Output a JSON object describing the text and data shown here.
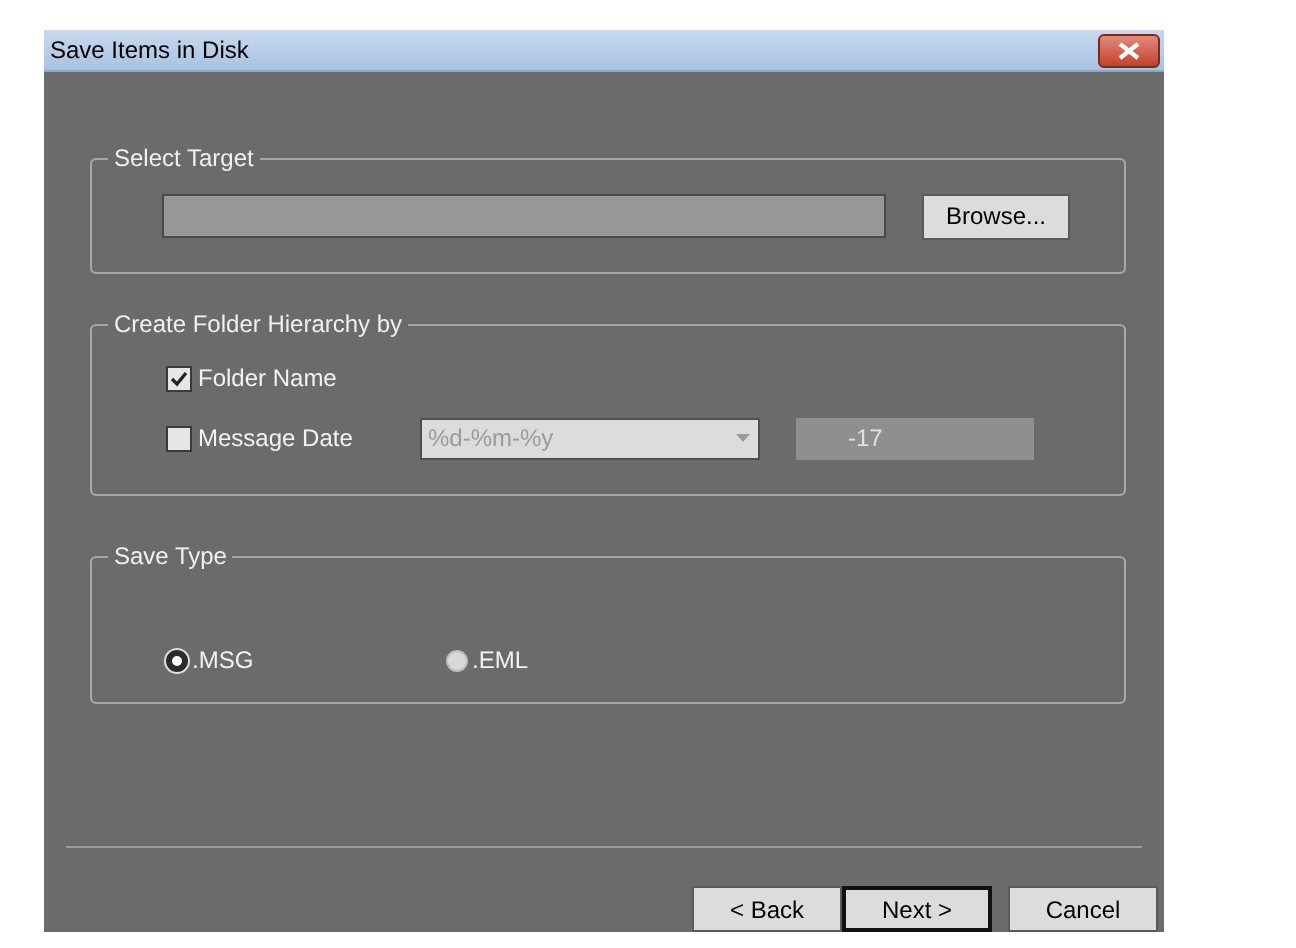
{
  "window": {
    "title": "Save Items in Disk"
  },
  "select_target": {
    "title": "Select Target",
    "browse_button": "Browse..."
  },
  "folder_hierarchy": {
    "title": "Create Folder Hierarchy by",
    "options": [
      {
        "label": "Folder Name",
        "checked": true
      },
      {
        "label": "Message Date",
        "checked": false
      }
    ],
    "date_format": "%d-%m-%y",
    "date_preview": "-17"
  },
  "save_type": {
    "title": "Save Type",
    "options": [
      {
        "label": ".MSG",
        "selected": true
      },
      {
        "label": ".EML",
        "selected": false
      }
    ]
  },
  "buttons": [
    {
      "label": "< Back",
      "default": false
    },
    {
      "label": "Next >",
      "default": true
    },
    {
      "label": "Cancel",
      "default": false
    }
  ]
}
